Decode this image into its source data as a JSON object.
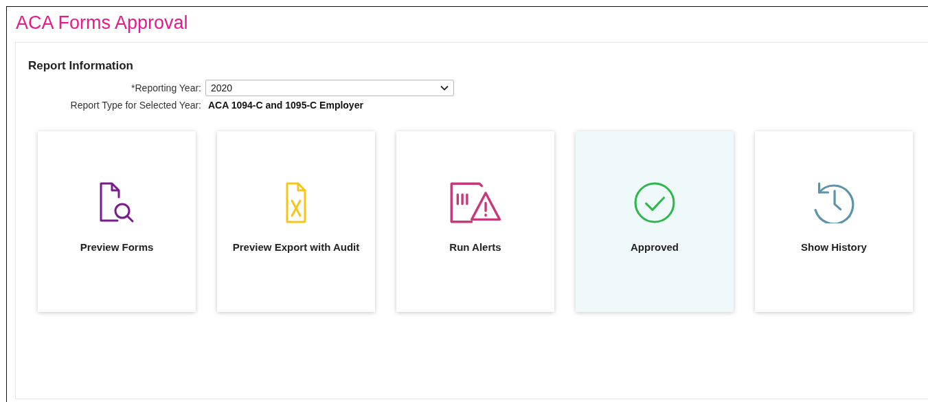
{
  "page": {
    "title": "ACA Forms Approval"
  },
  "report_information": {
    "heading": "Report Information",
    "reporting_year": {
      "label": "*Reporting Year:",
      "value": "2020"
    },
    "report_type": {
      "label": "Report Type for Selected Year:",
      "value": "ACA 1094-C and 1095-C Employer"
    }
  },
  "tiles": [
    {
      "kind": "preview",
      "label": "Preview Forms",
      "color": "#7b1a8c",
      "selected": false
    },
    {
      "kind": "export",
      "label": "Preview Export with Audit",
      "color": "#f5c518",
      "selected": false
    },
    {
      "kind": "alerts",
      "label": "Run Alerts",
      "color": "#c8387a",
      "selected": false
    },
    {
      "kind": "approved",
      "label": "Approved",
      "color": "#2db84a",
      "selected": true
    },
    {
      "kind": "history",
      "label": "Show History",
      "color": "#5b93ad",
      "selected": false
    }
  ]
}
